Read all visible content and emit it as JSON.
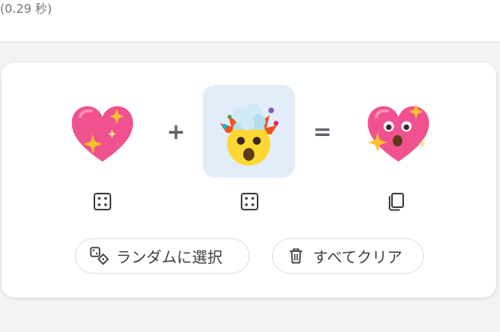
{
  "header": {
    "result_stats": "(0.29 秒)"
  },
  "mixer": {
    "left_emoji": "sparkling-heart",
    "right_emoji": "exploding-head",
    "result_emoji": "sparkling-heart-with-exploding-face",
    "plus_symbol": "+",
    "equals_symbol": "=",
    "left_tool": "dice-icon",
    "right_tool": "dice-icon",
    "result_tool": "copy-icon",
    "selected_color": "#e3edfa"
  },
  "actions": {
    "random_label": "ランダムに選択",
    "clear_label": "すべてクリア"
  }
}
